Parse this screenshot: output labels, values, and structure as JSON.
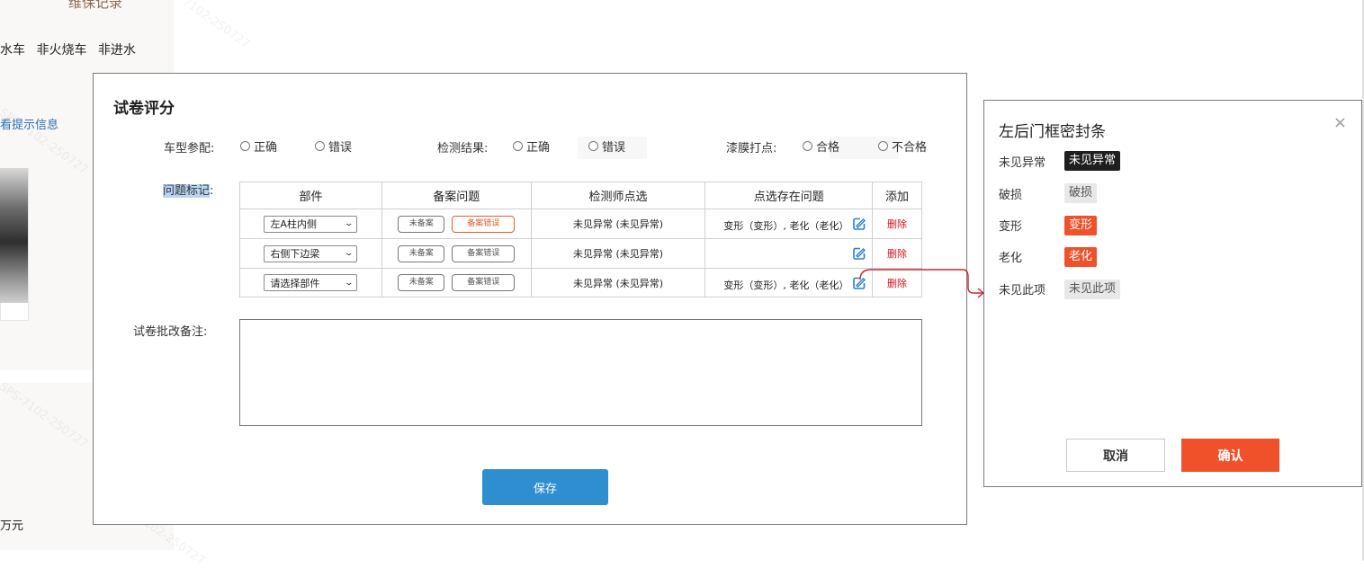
{
  "background": {
    "title": "维保记录",
    "tags": [
      "水车",
      "非火烧车",
      "非进水"
    ],
    "hint_link": "看提示信息",
    "price": "万元",
    "watermark_text": "SPS-7102-250727"
  },
  "dialog": {
    "title": "试卷评分",
    "fields": {
      "model_match_label": "车型参配:",
      "model_match_options": [
        "正确",
        "错误"
      ],
      "result_label": "检测结果:",
      "result_options": [
        "正确",
        "错误"
      ],
      "paint_label": "漆膜打点:",
      "paint_options": [
        "合格",
        "不合格"
      ]
    },
    "issue_label": "问题标记",
    "issue_colon": ":",
    "table": {
      "headers": [
        "部件",
        "备案问题",
        "检测师点选",
        "点选存在问题",
        "添加"
      ],
      "rows": [
        {
          "part": "左A柱内侧",
          "filing_a": "未备案",
          "filing_b": "备案错误",
          "filing_b_active": true,
          "inspector": "未见异常 (未见异常)",
          "issue": "变形（变形）, 老化（老化）",
          "action": "删除"
        },
        {
          "part": "右侧下边梁",
          "filing_a": "未备案",
          "filing_b": "备案错误",
          "filing_b_active": false,
          "inspector": "未见异常 (未见异常)",
          "issue": "",
          "action": "删除"
        },
        {
          "part": "请选择部件",
          "filing_a": "未备案",
          "filing_b": "备案错误",
          "filing_b_active": false,
          "inspector": "未见异常 (未见异常)",
          "issue": "变形（变形）, 老化（老化）",
          "action": "删除"
        }
      ]
    },
    "notes_label": "试卷批改备注:",
    "notes_value": "",
    "save_label": "保存"
  },
  "popover": {
    "title": "左后门框密封条",
    "close": "×",
    "options": [
      {
        "label": "未见异常",
        "chip": "未见异常",
        "state": "selected-dark"
      },
      {
        "label": "破损",
        "chip": "破损",
        "state": "unselected"
      },
      {
        "label": "变形",
        "chip": "变形",
        "state": "selected-orange"
      },
      {
        "label": "老化",
        "chip": "老化",
        "state": "selected-orange"
      },
      {
        "label": "未见此项",
        "chip": "未见此项",
        "state": "unselected"
      }
    ],
    "cancel_label": "取消",
    "ok_label": "确认"
  },
  "colors": {
    "accent_blue": "#2e8ecf",
    "accent_orange": "#f0512a",
    "delete_red": "#d0121b",
    "connector_red": "#c0282d"
  }
}
